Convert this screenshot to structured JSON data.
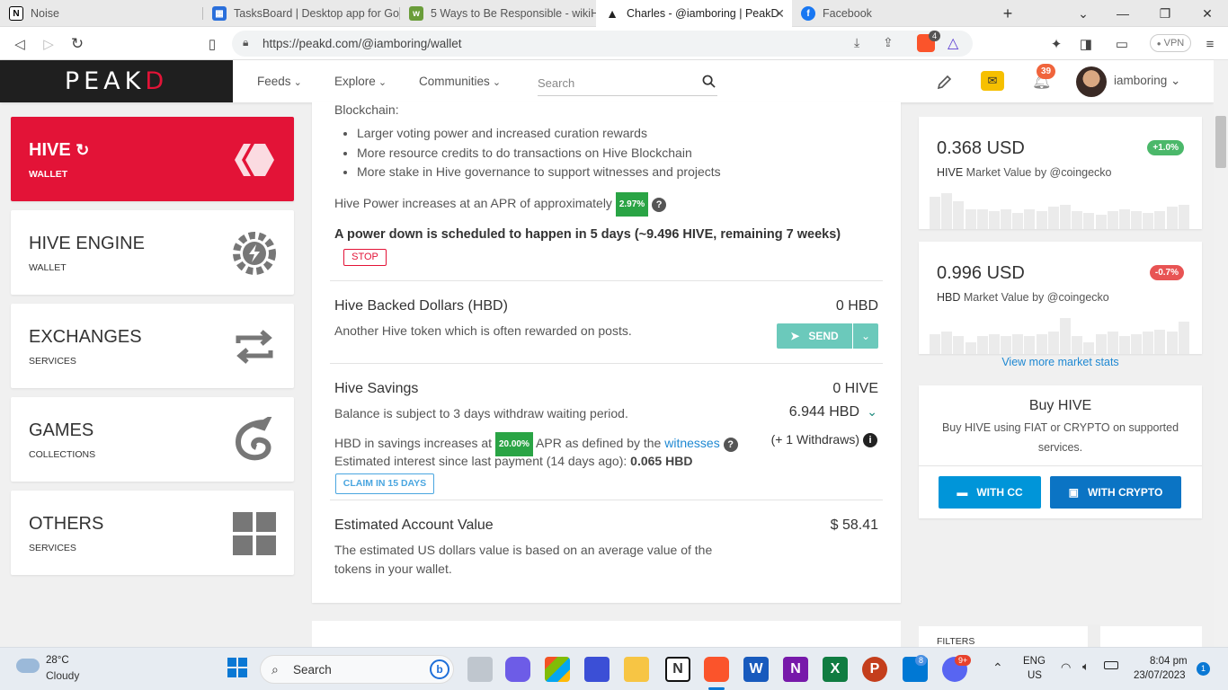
{
  "browser": {
    "tabs": [
      {
        "title": "Noise",
        "icon": "notion-icon"
      },
      {
        "title": "TasksBoard | Desktop app for Goo",
        "icon": "tasksboard-icon"
      },
      {
        "title": "5 Ways to Be Responsible - wikiHo",
        "icon": "wikihow-icon"
      },
      {
        "title": "Charles - @iamboring | PeakD",
        "icon": "peakd-icon"
      },
      {
        "title": "Facebook",
        "icon": "facebook-icon"
      }
    ],
    "url": "https://peakd.com/@iamboring/wallet",
    "brave_badge": "4",
    "vpn_label": "VPN"
  },
  "header": {
    "logo_main": "PEAK",
    "logo_accent": "D",
    "nav": [
      "Feeds",
      "Explore",
      "Communities"
    ],
    "search_placeholder": "Search",
    "notification_count": "39",
    "username": "iamboring"
  },
  "sidebar": [
    {
      "title": "HIVE",
      "subtitle": "WALLET"
    },
    {
      "title": "HIVE ENGINE",
      "subtitle": "WALLET"
    },
    {
      "title": "EXCHANGES",
      "subtitle": "SERVICES"
    },
    {
      "title": "GAMES",
      "subtitle": "COLLECTIONS"
    },
    {
      "title": "OTHERS",
      "subtitle": "SERVICES"
    }
  ],
  "main": {
    "intro": "Blockchain:",
    "bullets": [
      "Larger voting power and increased curation rewards",
      "More resource credits to do transactions on Hive Blockchain",
      "More stake in Hive governance to support witnesses and projects"
    ],
    "apr_text": "Hive Power increases at an APR of approximately",
    "apr_value": "2.97%",
    "powerdown": "A power down is scheduled to happen in 5 days (~9.496 HIVE, remaining 7 weeks)",
    "stop_label": "STOP",
    "hbd_title": "Hive Backed Dollars (HBD)",
    "hbd_value": "0 HBD",
    "hbd_desc": "Another Hive token which is often rewarded on posts.",
    "send_label": "SEND",
    "savings_title": "Hive Savings",
    "savings_hive": "0 HIVE",
    "savings_desc": "Balance is subject to 3 days withdraw waiting period.",
    "savings_hbd": "6.944 HBD",
    "savings_apr_pre": "HBD in savings increases at",
    "savings_apr_value": "20.00%",
    "savings_apr_post": "APR as defined by the",
    "witnesses_link": "witnesses",
    "withdraws": "(+ 1 Withdraws)",
    "interest_text": "Estimated interest since last payment (14 days ago):",
    "interest_value": "0.065 HBD",
    "claim_label": "CLAIM IN 15 DAYS",
    "eav_title": "Estimated Account Value",
    "eav_value": "$ 58.41",
    "eav_desc": "The estimated US dollars value is based on an average value of the tokens in your wallet."
  },
  "market": {
    "hive": {
      "price": "0.368 USD",
      "token": "HIVE",
      "label": "Market Value by @coingecko",
      "change": "+1.0%",
      "bars": [
        0.8,
        0.9,
        0.7,
        0.5,
        0.5,
        0.45,
        0.5,
        0.4,
        0.5,
        0.45,
        0.55,
        0.6,
        0.45,
        0.4,
        0.35,
        0.45,
        0.5,
        0.45,
        0.4,
        0.45,
        0.55,
        0.6
      ]
    },
    "hbd": {
      "price": "0.996 USD",
      "token": "HBD",
      "label": "Market Value by @coingecko",
      "change": "-0.7%",
      "bars": [
        0.5,
        0.55,
        0.45,
        0.3,
        0.45,
        0.5,
        0.45,
        0.5,
        0.45,
        0.5,
        0.55,
        0.9,
        0.45,
        0.3,
        0.5,
        0.55,
        0.45,
        0.5,
        0.55,
        0.6,
        0.55,
        0.8
      ]
    },
    "more_link": "View more market stats"
  },
  "buy": {
    "title": "Buy HIVE",
    "desc": "Buy HIVE using FIAT or CRYPTO on supported services.",
    "cc_label": "WITH CC",
    "crypto_label": "WITH CRYPTO"
  },
  "filters_label": "FILTERS",
  "taskbar": {
    "temp": "28°C",
    "weather": "Cloudy",
    "search": "Search",
    "lang1": "ENG",
    "lang2": "US",
    "time": "8:04 pm",
    "date": "23/07/2023",
    "notif": "1",
    "onenote_badge": "8",
    "discord_badge": "9+"
  },
  "colors": {
    "accent": "#e31337",
    "green": "#2aa445",
    "teal": "#6bc9bb",
    "blue": "#0095d9",
    "dark_blue": "#0b74c4"
  }
}
